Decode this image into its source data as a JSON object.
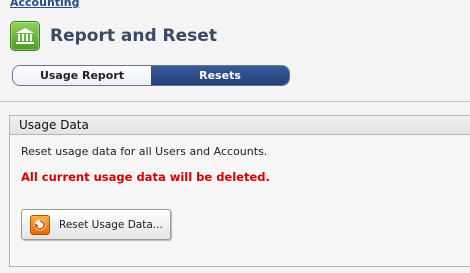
{
  "breadcrumb": {
    "label": "Accounting"
  },
  "header": {
    "title": "Report and Reset",
    "icon": "bank-icon",
    "icon_color": "#5cae2e"
  },
  "tabs": [
    {
      "label": "Usage Report",
      "active": false
    },
    {
      "label": "Resets",
      "active": true
    }
  ],
  "panel": {
    "title": "Usage Data",
    "description": "Reset usage data for all Users and Accounts.",
    "warning": "All current usage data will be deleted.",
    "warning_color": "#dd0000",
    "reset_button": {
      "label": "Reset Usage Data...",
      "icon": "reset-icon"
    }
  },
  "colors": {
    "active_tab": "#2c4a85",
    "link": "#2a4a8a"
  }
}
